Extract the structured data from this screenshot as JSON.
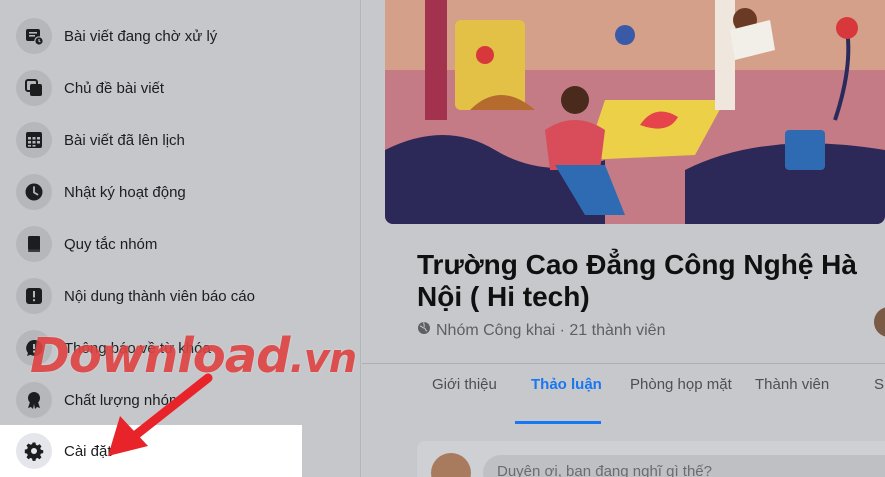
{
  "sidebar": {
    "items": [
      {
        "label": "Bài viết đang chờ xử lý",
        "icon": "pending-posts-icon"
      },
      {
        "label": "Chủ đề bài viết",
        "icon": "post-topics-icon"
      },
      {
        "label": "Bài viết đã lên lịch",
        "icon": "calendar-icon"
      },
      {
        "label": "Nhật ký hoạt động",
        "icon": "clock-icon"
      },
      {
        "label": "Quy tắc nhóm",
        "icon": "book-icon"
      },
      {
        "label": "Nội dung thành viên báo cáo",
        "icon": "report-icon"
      },
      {
        "label": "Thông báo về từ khóa",
        "icon": "keyword-alert-icon"
      },
      {
        "label": "Chất lượng nhóm",
        "icon": "badge-icon"
      },
      {
        "label": "Cài đặt",
        "icon": "gear-icon"
      }
    ]
  },
  "group": {
    "title": "Trường Cao Đẳng Công Nghệ Hà Nội ( Hi tech)",
    "meta": "Nhóm Công khai · 21 thành viên"
  },
  "tabs": [
    {
      "label": "Giới thiệu"
    },
    {
      "label": "Thảo luận",
      "active": true
    },
    {
      "label": "Phòng họp mặt"
    },
    {
      "label": "Thành viên"
    },
    {
      "label": "Sự"
    }
  ],
  "composer": {
    "placeholder": "Duyên ơi, bạn đang nghĩ gì thế?"
  },
  "watermark": {
    "main": "Download",
    "suffix": ".vn"
  },
  "colors": {
    "accent": "#1877f2",
    "watermark": "#dd3636",
    "arrow": "#e8242a"
  }
}
